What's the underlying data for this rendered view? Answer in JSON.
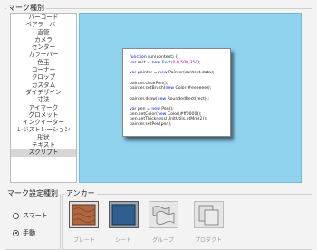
{
  "mark_types": {
    "title": "マーク種別",
    "items": [
      "バーコード",
      "ベアラーバー",
      "直管",
      "カメラ",
      "センター",
      "カラーバー",
      "色玉",
      "コーナー",
      "クロップ",
      "カスタム",
      "ダイデザイン",
      "寸法",
      "アイマーク",
      "グロメット",
      "インクイーター",
      "レジストレーション",
      "形状",
      "テキスト",
      "スクリプト"
    ],
    "selected": "スクリプト"
  },
  "code": {
    "lines": [
      [
        {
          "t": "function ",
          "c": "kw"
        },
        {
          "t": "run(context) {",
          "c": "plain"
        }
      ],
      [
        {
          "t": "   var ",
          "c": "kw"
        },
        {
          "t": "rect = ",
          "c": "plain"
        },
        {
          "t": "new ",
          "c": "kw"
        },
        {
          "t": "Rect(",
          "c": "cls"
        },
        {
          "t": "0,0,500,350",
          "c": "num"
        },
        {
          "t": ");",
          "c": "plain"
        }
      ],
      [],
      [
        {
          "t": "   var ",
          "c": "kw"
        },
        {
          "t": "painter = ",
          "c": "plain"
        },
        {
          "t": "new ",
          "c": "kw"
        },
        {
          "t": "Painter(context.data);",
          "c": "plain"
        }
      ],
      [],
      [
        {
          "t": "   painter.clearPen();",
          "c": "plain"
        }
      ],
      [
        {
          "t": "   painter.setBrush(",
          "c": "plain"
        },
        {
          "t": "new ",
          "c": "kw"
        },
        {
          "t": "Color(#eeeeee));",
          "c": "plain"
        }
      ],
      [],
      [
        {
          "t": "   painter.draw(",
          "c": "plain"
        },
        {
          "t": "new ",
          "c": "kw"
        },
        {
          "t": "RoundedRect(rect));",
          "c": "plain"
        }
      ],
      [],
      [
        {
          "t": "   var ",
          "c": "kw"
        },
        {
          "t": "pen = ",
          "c": "plain"
        },
        {
          "t": "new ",
          "c": "kw"
        },
        {
          "t": "Pen();",
          "c": "plain"
        }
      ],
      [
        {
          "t": "   pen.setColor(",
          "c": "plain"
        },
        {
          "t": "new ",
          "c": "kw"
        },
        {
          "t": "Color(#ff0000));",
          "c": "plain"
        }
      ],
      [
        {
          "t": "   pen.setThickness(UnitUtils.ptMm(2));",
          "c": "plain"
        }
      ],
      [
        {
          "t": "   painter.setPen(pen);",
          "c": "plain"
        }
      ]
    ]
  },
  "mark_setting": {
    "title": "マーク設定種別",
    "options": [
      {
        "label": "スマート",
        "checked": false
      },
      {
        "label": "手動",
        "checked": true
      }
    ]
  },
  "anchor": {
    "title": "アンカー",
    "options": [
      {
        "label": "プレート",
        "icon": "plate-icon"
      },
      {
        "label": "シート",
        "icon": "sheet-icon"
      },
      {
        "label": "グループ",
        "icon": "group-icon"
      },
      {
        "label": "プロダクト",
        "icon": "product-icon"
      }
    ]
  },
  "colors": {
    "preview_bg": "#8fd3ef",
    "list_selected": "#d6d6d6",
    "plate": "#b0673f",
    "sheet": "#2f5f8f"
  }
}
